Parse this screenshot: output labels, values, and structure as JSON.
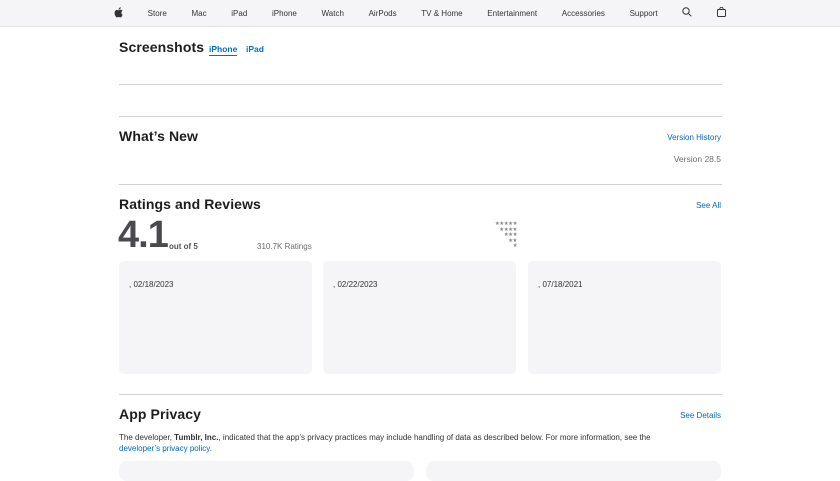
{
  "nav": {
    "items": [
      "Store",
      "Mac",
      "iPad",
      "iPhone",
      "Watch",
      "AirPods",
      "TV & Home",
      "Entertainment",
      "Accessories",
      "Support"
    ]
  },
  "screenshots": {
    "title": "Screenshots",
    "tabs": [
      "iPhone",
      "iPad"
    ]
  },
  "whats_new": {
    "title": "What’s New",
    "history": "Version History",
    "version": "Version 28.5"
  },
  "ratings": {
    "title": "Ratings and Reviews",
    "see_all": "See All",
    "score": "4.1",
    "out_of": "out of 5",
    "count": "310.7K Ratings",
    "stars": [
      "★★★★★",
      "★★★★",
      "★★★",
      "★★",
      "★"
    ],
    "reviews": [
      {
        "date": ", 02/18/2023"
      },
      {
        "date": ", 02/22/2023"
      },
      {
        "date": ", 07/18/2021"
      }
    ]
  },
  "privacy": {
    "title": "App Privacy",
    "see_details": "See Details",
    "text_pre": "The developer, ",
    "developer": "Tumblr, Inc.",
    "text_post": ", indicated that the app’s privacy practices may include handling of data as described below. For more information, see the",
    "policy_link": "developer’s privacy policy",
    "period": "."
  }
}
